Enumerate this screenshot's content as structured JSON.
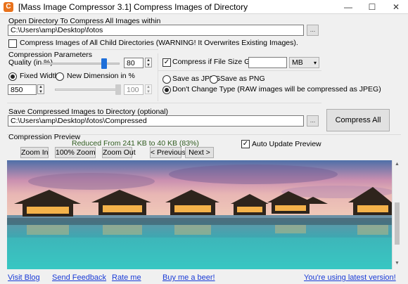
{
  "window": {
    "title": "[Mass Image Compressor 3.1] Compress Images of Directory",
    "app_icon": "C",
    "min_label": "—",
    "max_label": "☐",
    "close_label": "✕"
  },
  "source": {
    "label": "Open Directory To Compress All Images within",
    "path": "C:\\Users\\amp\\Desktop\\fotos",
    "browse_label": "...",
    "child_dirs_label": "Compress Images of All Child Directories (WARNING! It Overwrites Existing Images).",
    "child_dirs_checked": false
  },
  "params": {
    "section_label": "Compression Parameters",
    "quality_label": "Quality (in %)",
    "quality_value": "80",
    "quality_level": 0.8,
    "fixed_width_label": "Fixed Width",
    "fixed_width_selected": true,
    "new_dimension_label": "New Dimension in %",
    "new_dimension_selected": false,
    "width_value": "850",
    "dimension_value": "100",
    "size_check_label": "Compress if File Size Greater than",
    "size_check_checked": true,
    "size_value": "",
    "size_unit": "MB",
    "save_jpeg_label": "Save as JPEG",
    "save_png_label": "Save as PNG",
    "keep_type_label": "Don't Change Type (RAW images will be compressed as JPEG)",
    "keep_type_selected": true
  },
  "output": {
    "label": "Save Compressed Images to Directory (optional)",
    "path": "C:\\Users\\amp\\Desktop\\fotos\\Compressed",
    "browse_label": "...",
    "compress_all_label": "Compress All"
  },
  "preview": {
    "section_label": "Compression Preview",
    "reduction_text": "Reduced From 241 KB to 40 KB (83%)",
    "zoom_in_label": "Zoom In",
    "zoom_100_label": "100% Zoom",
    "zoom_out_label": "Zoom Out",
    "previous_label": "< Previous",
    "next_label": "Next >",
    "auto_update_label": "Auto Update Preview",
    "auto_update_checked": true
  },
  "footer": {
    "visit_blog": "Visit Blog",
    "send_feedback": "Send Feedback",
    "rate_me": "Rate me",
    "buy_beer": "Buy me a beer!",
    "latest_version": "You're using latest version!"
  },
  "colors": {
    "accent": "#1e6fd9",
    "link": "#1a3bd6",
    "reduction_text": "#2e5a1e"
  }
}
